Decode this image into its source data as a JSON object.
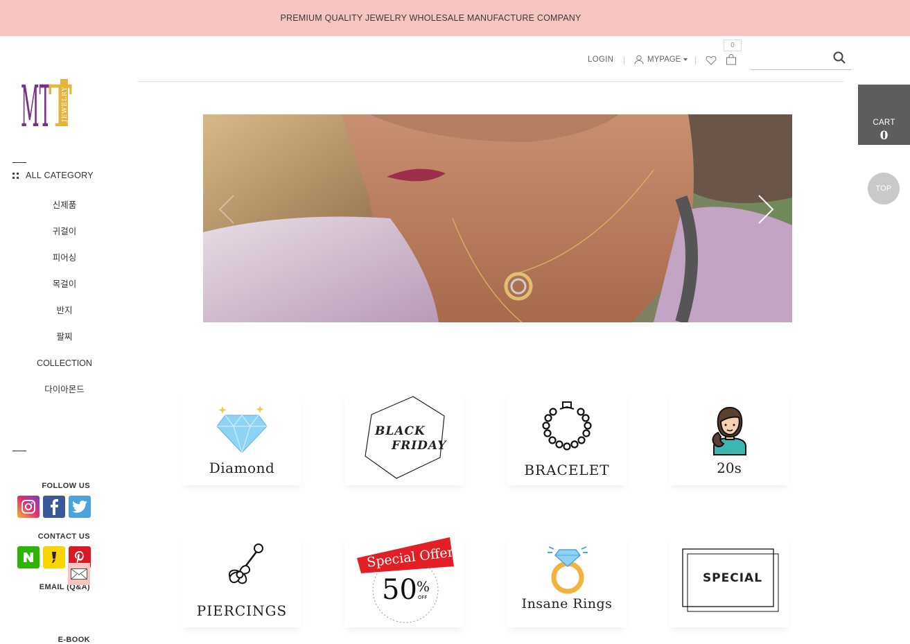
{
  "announcement": "PREMIUM QUALITY JEWELRY WHOLESALE MANUFACTURE COMPANY",
  "logo": {
    "letters": "MT",
    "side_text": "JEWELRY",
    "colors": {
      "m": "#7a2f8c",
      "t": "#e6b33c"
    }
  },
  "sidebar": {
    "all_category": "ALL CATEGORY",
    "categories": [
      "신제품",
      "귀걸이",
      "피어싱",
      "목걸이",
      "반지",
      "팔찌",
      "COLLECTION",
      "다이아몬드"
    ],
    "follow_us": "FOLLOW US",
    "contact_us": "CONTACT US",
    "email": "EMAIL (Q&A)",
    "ebook": "E-BOOK",
    "follow_icons": [
      "instagram-icon",
      "facebook-icon",
      "twitter-icon"
    ],
    "contact_icons": [
      "naver-icon",
      "kakao-icon",
      "pinterest-icon"
    ]
  },
  "header": {
    "login": "LOGIN",
    "mypage": "MYPAGE",
    "bag_count": "0",
    "search_placeholder": ""
  },
  "float": {
    "cart_label": "CART",
    "cart_count": "0",
    "top_label": "TOP"
  },
  "tiles": [
    {
      "label": "Diamond",
      "icon": "diamond-icon"
    },
    {
      "label": "BLACK FRIDAY",
      "line1": "BLACK",
      "line2": "FRIDAY",
      "icon": "hexagon-icon"
    },
    {
      "label": "BRACELET",
      "icon": "bracelet-icon"
    },
    {
      "label": "20s",
      "icon": "woman-avatar-icon"
    },
    {
      "label": "PIERCINGS",
      "icon": "piercing-icon"
    },
    {
      "label": "Special Offer",
      "percent": "50",
      "pct_sign": "%",
      "off": "OFF",
      "icon": "special-offer-icon"
    },
    {
      "label": "Insane Rings",
      "icon": "ring-icon"
    },
    {
      "label": "SPECIAL",
      "icon": "special-frame-icon"
    }
  ]
}
